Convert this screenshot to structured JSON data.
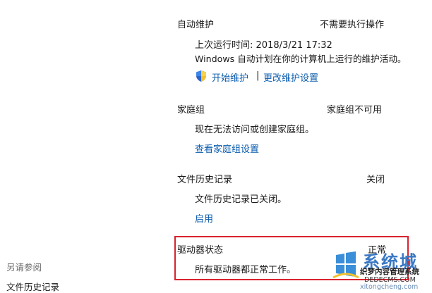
{
  "maintenance": {
    "title": "自动维护",
    "status": "不需要执行操作",
    "last_run": "上次运行时间: 2018/3/21 17:32",
    "description": "Windows 自动计划在你的计算机上运行的维护活动。",
    "start_link": "开始维护",
    "separator": "|",
    "settings_link": "更改维护设置",
    "shield_icon": "uac-shield-icon"
  },
  "homegroup": {
    "title": "家庭组",
    "status": "家庭组不可用",
    "description": "现在无法访问或创建家庭组。",
    "settings_link": "查看家庭组设置"
  },
  "file_history": {
    "title": "文件历史记录",
    "status": "关闭",
    "description": "文件历史记录已关闭。",
    "enable_link": "启用"
  },
  "drive_status": {
    "title": "驱动器状态",
    "status": "正常",
    "description": "所有驱动器都正常工作。",
    "highlight_color": "#d9232e"
  },
  "see_also": {
    "heading": "另请参阅",
    "items": [
      "文件历史记录"
    ]
  },
  "watermark": {
    "title": "系统城",
    "subtitle": "织梦内容管理系统",
    "url1": "DEDECMS.COM",
    "url2": "xitongcheng.com"
  },
  "colors": {
    "link": "#0b5cad",
    "text": "#1a1a1a",
    "muted": "#6a6a6a"
  }
}
